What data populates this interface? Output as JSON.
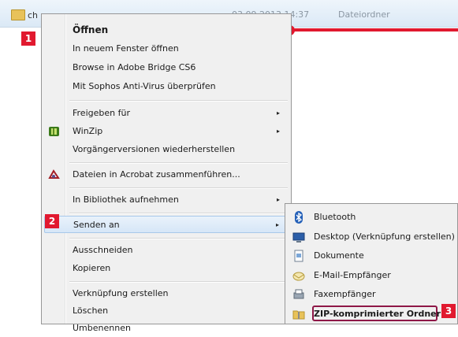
{
  "explorer": {
    "file_name": "ch",
    "date_modified": "03.09.2013 14:37",
    "file_type": "Dateiordner"
  },
  "menu": {
    "items": [
      {
        "label": "Öffnen",
        "bold": true
      },
      {
        "label": "In neuem Fenster öffnen"
      },
      {
        "label": "Browse in Adobe Bridge CS6"
      },
      {
        "label": "Mit Sophos Anti-Virus überprüfen"
      },
      {
        "label": "Freigeben für",
        "submenu": true
      },
      {
        "label": "WinZip",
        "icon": "winzip-icon",
        "submenu": true
      },
      {
        "label": "Vorgängerversionen wiederherstellen"
      },
      {
        "label": "Dateien in Acrobat zusammenführen...",
        "icon": "acrobat-icon"
      },
      {
        "label": "In Bibliothek aufnehmen",
        "submenu": true
      },
      {
        "label": "Senden an",
        "submenu": true,
        "highlighted": true
      },
      {
        "label": "Ausschneiden"
      },
      {
        "label": "Kopieren"
      },
      {
        "label": "Verknüpfung erstellen"
      },
      {
        "label": "Löschen"
      },
      {
        "label": "Umbenennen"
      }
    ],
    "arrow": "▸"
  },
  "submenu": {
    "items": [
      {
        "label": "Bluetooth",
        "icon": "bluetooth-icon"
      },
      {
        "label": "Desktop (Verknüpfung erstellen)",
        "icon": "desktop-icon"
      },
      {
        "label": "Dokumente",
        "icon": "documents-icon"
      },
      {
        "label": "E-Mail-Empfänger",
        "icon": "mail-icon"
      },
      {
        "label": "Faxempfänger",
        "icon": "fax-icon"
      },
      {
        "label": "ZIP-komprimierter Ordner",
        "icon": "zip-folder-icon",
        "emphasized": true
      }
    ]
  },
  "badges": [
    "1",
    "2",
    "3"
  ],
  "colors": {
    "accent_red": "#e1192f",
    "zip_highlight": "#8e1747",
    "menu_background": "#f0f0f0"
  }
}
